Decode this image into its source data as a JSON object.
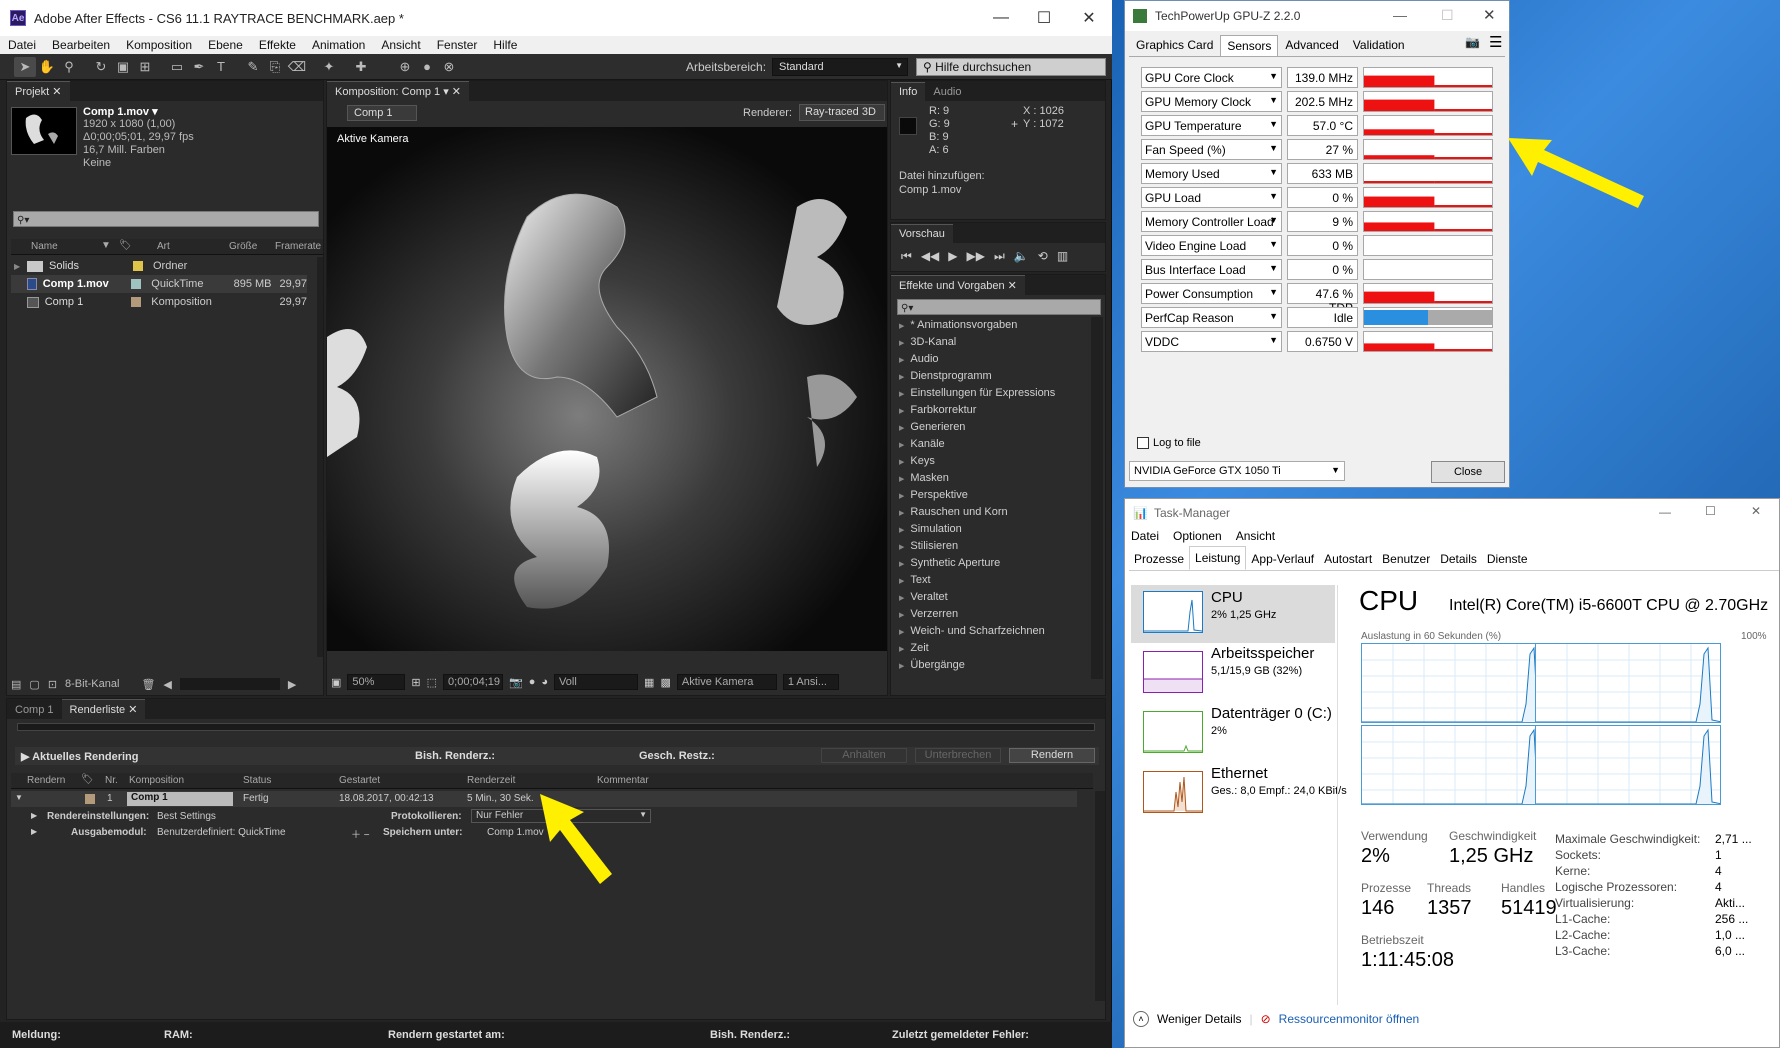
{
  "ae": {
    "title": "Adobe After Effects - CS6 11.1 RAYTRACE BENCHMARK.aep *",
    "logo": "Ae",
    "menu": [
      "Datei",
      "Bearbeiten",
      "Komposition",
      "Ebene",
      "Effekte",
      "Animation",
      "Ansicht",
      "Fenster",
      "Hilfe"
    ],
    "workspace_label": "Arbeitsbereich:",
    "workspace_value": "Standard",
    "help_placeholder": "Hilfe durchsuchen",
    "project": {
      "tab": "Projekt",
      "item_name": "Comp 1.mov ▾",
      "item_details": [
        "1920 x 1080 (1,00)",
        "Δ0;00;05;01, 29,97 fps",
        "16,7 Mill. Farben",
        "Keine"
      ],
      "columns": [
        "Name",
        "Art",
        "Größe",
        "Framerate"
      ],
      "rows": [
        {
          "name": "Solids",
          "type": "Ordner",
          "size": "",
          "rate": "",
          "color": "#e0c34a",
          "icon": "folder-icon"
        },
        {
          "name": "Comp 1.mov",
          "type": "QuickTime",
          "size": "895 MB",
          "rate": "29,97",
          "color": "#9ec3c0",
          "icon": "movie-icon"
        },
        {
          "name": "Comp 1",
          "type": "Komposition",
          "size": "",
          "rate": "29,97",
          "color": "#b39a7a",
          "icon": "composition-icon"
        }
      ],
      "footer_bits": "8-Bit-Kanal"
    },
    "comp": {
      "tab": "Komposition: Comp 1",
      "subtab": "Comp 1",
      "renderer_label": "Renderer:",
      "renderer_value": "Ray-traced 3D",
      "camera_label": "Aktive Kamera",
      "zoom": "50%",
      "timecode": "0;00;04;19",
      "resolution": "Voll",
      "view": "Aktive Kamera",
      "views": "1 Ansi..."
    },
    "info": {
      "tab1": "Info",
      "tab2": "Audio",
      "r": "R:  9",
      "g": "G:  9",
      "b": "B:  9",
      "a": "A:  6",
      "x": "X : 1026",
      "y": "Y : 1072",
      "add_file": "Datei hinzufügen:",
      "file": "Comp 1.mov"
    },
    "preview": {
      "tab": "Vorschau"
    },
    "effects": {
      "tab": "Effekte und Vorgaben",
      "items": [
        "* Animationsvorgaben",
        "3D-Kanal",
        "Audio",
        "Dienstprogramm",
        "Einstellungen für Expressions",
        "Farbkorrektur",
        "Generieren",
        "Kanäle",
        "Keys",
        "Masken",
        "Perspektive",
        "Rauschen und Korn",
        "Simulation",
        "Stilisieren",
        "Synthetic Aperture",
        "Text",
        "Veraltet",
        "Verzerren",
        "Weich- und Scharfzeichnen",
        "Zeit",
        "Übergänge"
      ]
    },
    "render": {
      "tab1": "Comp 1",
      "tab2": "Renderliste",
      "current": "Aktuelles Rendering",
      "elapsed": "Bish. Renderz.:",
      "remaining": "Gesch. Restz.:",
      "btn_pause": "Anhalten",
      "btn_stop": "Unterbrechen",
      "btn_render": "Rendern",
      "columns": [
        "Rendern",
        "Nr.",
        "Komposition",
        "Status",
        "Gestartet",
        "Renderzeit",
        "Kommentar"
      ],
      "item": {
        "nr": "1",
        "comp": "Comp 1",
        "status": "Fertig",
        "started": "18.08.2017, 00:42:13",
        "time": "5 Min., 30 Sek."
      },
      "settings_label": "Rendereinstellungen:",
      "settings_value": "Best Settings",
      "log_label": "Protokollieren:",
      "log_value": "Nur Fehler",
      "output_label": "Ausgabemodul:",
      "output_value": "Benutzerdefiniert: QuickTime",
      "save_label": "Speichern unter:",
      "save_value": "Comp 1.mov"
    },
    "status": {
      "msg": "Meldung:",
      "ram": "RAM:",
      "started": "Rendern gestartet am:",
      "elapsed": "Bish. Renderz.:",
      "errors": "Zuletzt gemeldeter Fehler:"
    }
  },
  "gpuz": {
    "title": "TechPowerUp GPU-Z 2.2.0",
    "tabs": [
      "Graphics Card",
      "Sensors",
      "Advanced",
      "Validation"
    ],
    "sensors": [
      {
        "name": "GPU Core Clock",
        "value": "139.0 MHz",
        "level": 0.6
      },
      {
        "name": "GPU Memory Clock",
        "value": "202.5 MHz",
        "level": 0.6
      },
      {
        "name": "GPU Temperature",
        "value": "57.0 °C",
        "level": 0.3
      },
      {
        "name": "Fan Speed (%)",
        "value": "27 %",
        "level": 0.2
      },
      {
        "name": "Memory Used",
        "value": "633 MB",
        "level": 0.1
      },
      {
        "name": "GPU Load",
        "value": "0 %",
        "level": 0.55
      },
      {
        "name": "Memory Controller Load",
        "value": "9 %",
        "level": 0.45
      },
      {
        "name": "Video Engine Load",
        "value": "0 %",
        "level": 0
      },
      {
        "name": "Bus Interface Load",
        "value": "0 %",
        "level": 0
      },
      {
        "name": "Power Consumption",
        "value": "47.6 % TDP",
        "level": 0.6
      },
      {
        "name": "PerfCap Reason",
        "value": "Idle",
        "level": 0.5
      },
      {
        "name": "VDDC",
        "value": "0.6750 V",
        "level": 0.4
      }
    ],
    "log": "Log to file",
    "gpu": "NVIDIA GeForce GTX 1050 Ti",
    "close": "Close",
    "graph_color": "#ee1111",
    "perfcap_color": "#2b8fe0"
  },
  "tm": {
    "title": "Task-Manager",
    "menu": [
      "Datei",
      "Optionen",
      "Ansicht"
    ],
    "tabs": [
      "Prozesse",
      "Leistung",
      "App-Verlauf",
      "Autostart",
      "Benutzer",
      "Details",
      "Dienste"
    ],
    "side": [
      {
        "name": "CPU",
        "sub": "2% 1,25 GHz",
        "color": "#1a7ac4"
      },
      {
        "name": "Arbeitsspeicher",
        "sub": "5,1/15,9 GB (32%)",
        "color": "#8b1fb0"
      },
      {
        "name": "Datenträger 0 (C:)",
        "sub": "2%",
        "color": "#4da82e"
      },
      {
        "name": "Ethernet",
        "sub": "Ges.: 8,0 Empf.: 24,0 KBit/s",
        "color": "#b0561a"
      }
    ],
    "cpu_title": "CPU",
    "cpu_model": "Intel(R) Core(TM) i5-6600T CPU @ 2.70GHz",
    "util_label": "Auslastung in 60 Sekunden (%)",
    "util_max": "100%",
    "stats": {
      "use_l": "Verwendung",
      "use_v": "2%",
      "speed_l": "Geschwindigkeit",
      "speed_v": "1,25 GHz",
      "proc_l": "Prozesse",
      "proc_v": "146",
      "thr_l": "Threads",
      "thr_v": "1357",
      "hnd_l": "Handles",
      "hnd_v": "51419",
      "up_l": "Betriebszeit",
      "up_v": "1:11:45:08"
    },
    "right": [
      {
        "k": "Maximale Geschwindigkeit:",
        "v": "2,71 ..."
      },
      {
        "k": "Sockets:",
        "v": "1"
      },
      {
        "k": "Kerne:",
        "v": "4"
      },
      {
        "k": "Logische Prozessoren:",
        "v": "4"
      },
      {
        "k": "Virtualisierung:",
        "v": "Akti..."
      },
      {
        "k": "L1-Cache:",
        "v": "256 ..."
      },
      {
        "k": "L2-Cache:",
        "v": "1,0 ..."
      },
      {
        "k": "L3-Cache:",
        "v": "6,0 ..."
      }
    ],
    "fewer": "Weniger Details",
    "resmon": "Ressourcenmonitor öffnen"
  }
}
